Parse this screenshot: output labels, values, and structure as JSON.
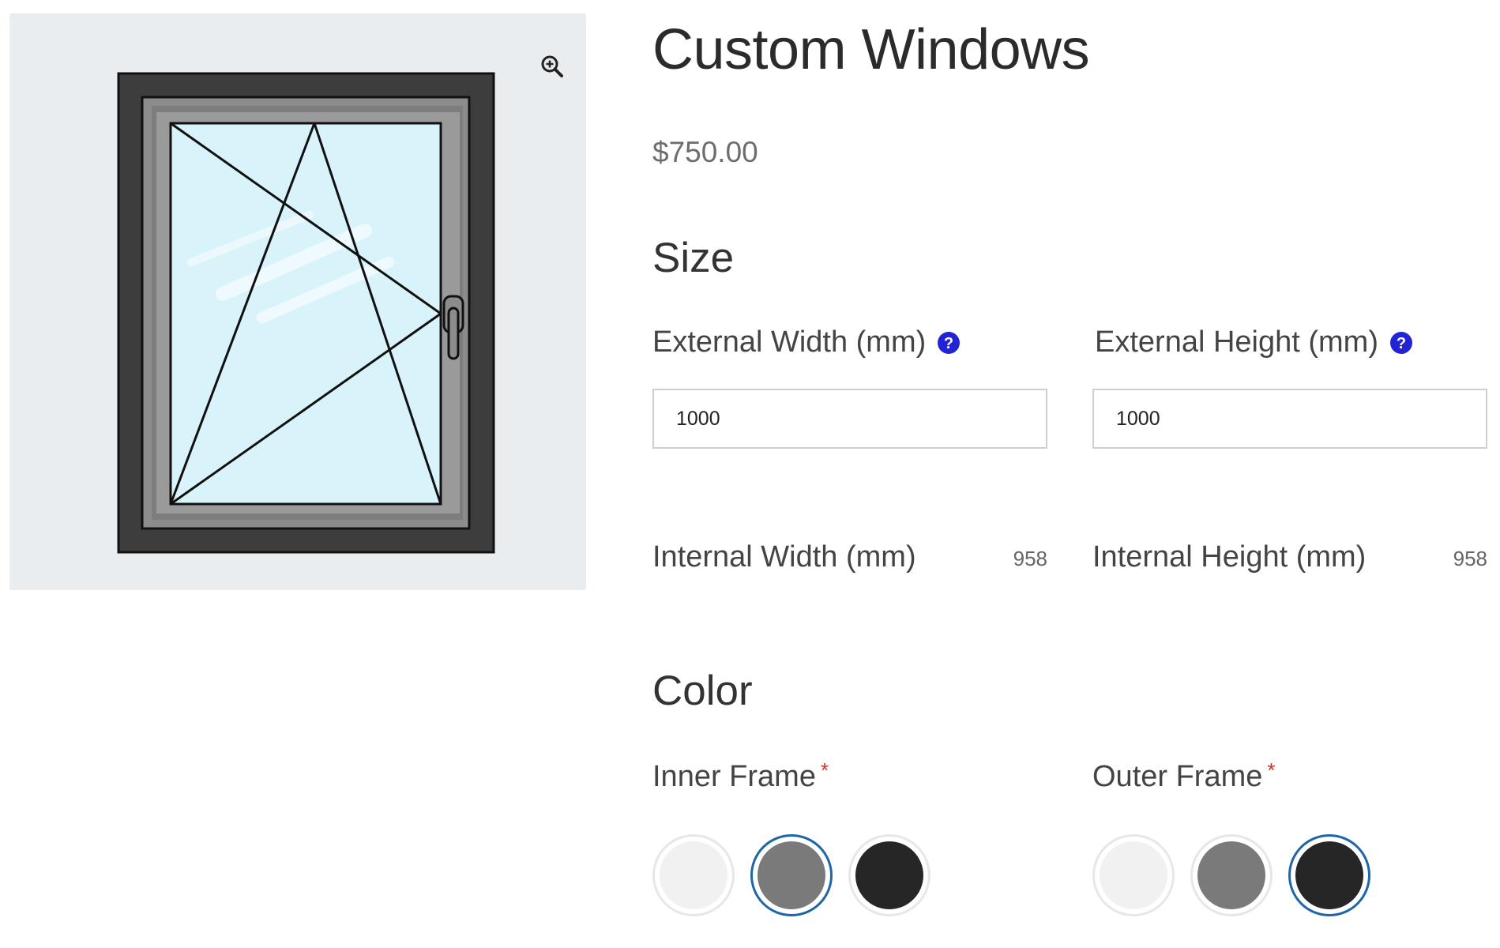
{
  "product": {
    "title": "Custom Windows",
    "price": "$750.00"
  },
  "gallery": {
    "zoom_icon": "zoom-in-icon",
    "image": "window-illustration",
    "colors": {
      "panel": "#eaedf0",
      "outer_frame": "#3d3d3d",
      "inner_frame": "#8c8c8c",
      "glass": "#d9f3fb"
    }
  },
  "size": {
    "heading": "Size",
    "external_width": {
      "label": "External Width (mm)",
      "value": "1000",
      "help_icon": "question-circle-icon"
    },
    "external_height": {
      "label": "External Height (mm)",
      "value": "1000",
      "help_icon": "question-circle-icon"
    },
    "internal_width": {
      "label": "Internal Width (mm)",
      "value": "958"
    },
    "internal_height": {
      "label": "Internal Height (mm)",
      "value": "958"
    }
  },
  "color": {
    "heading": "Color",
    "inner_frame": {
      "label": "Inner Frame",
      "required_mark": "*",
      "options": [
        "#f1f1f1",
        "#7a7a7a",
        "#262626"
      ],
      "selected_index": 1
    },
    "outer_frame": {
      "label": "Outer Frame",
      "required_mark": "*",
      "options": [
        "#f1f1f1",
        "#7a7a7a",
        "#262626"
      ],
      "selected_index": 2
    }
  },
  "accent": {
    "help": "#2323d6",
    "selected_ring": "#1f66a8",
    "required": "#d9302a"
  }
}
